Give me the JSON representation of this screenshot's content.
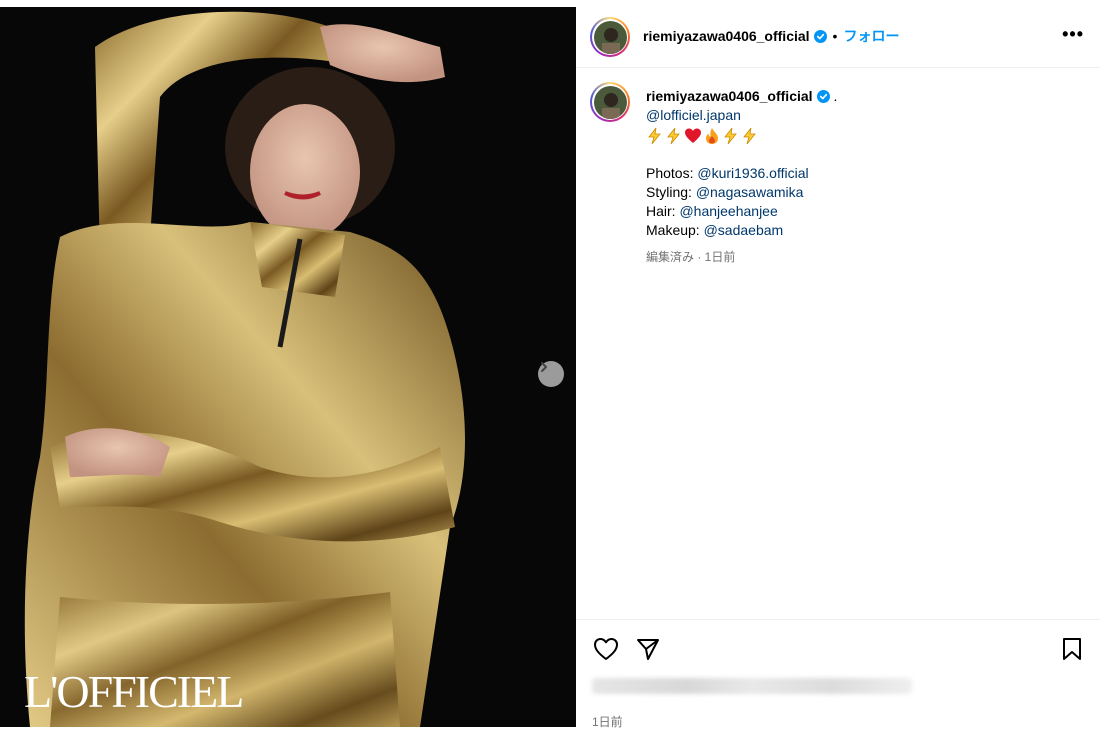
{
  "post": {
    "image_watermark": "L'OFFICIEL",
    "username": "riemiyazawa0406_official",
    "separator": "•",
    "follow_label": "フォロー",
    "more_label": "•••",
    "caption": {
      "username": "riemiyazawa0406_official",
      "first_text": ".",
      "mention_1": "@lofficiel.japan",
      "emoji_icons": [
        "lightning-icon",
        "lightning-icon",
        "heart-icon",
        "fire-icon",
        "lightning-icon",
        "lightning-icon"
      ],
      "credits": [
        {
          "label": "Photos:",
          "handle": "@kuri1936.official"
        },
        {
          "label": "Styling:",
          "handle": "@nagasawamika"
        },
        {
          "label": "Hair:",
          "handle": "@hanjeehanjee"
        },
        {
          "label": "Makeup:",
          "handle": "@sadaebam"
        }
      ],
      "meta": "編集済み · 1日前"
    },
    "time_ago": "1日前",
    "colors": {
      "link": "#00376b",
      "follow": "#0095f6",
      "verified": "#0095f6"
    }
  }
}
